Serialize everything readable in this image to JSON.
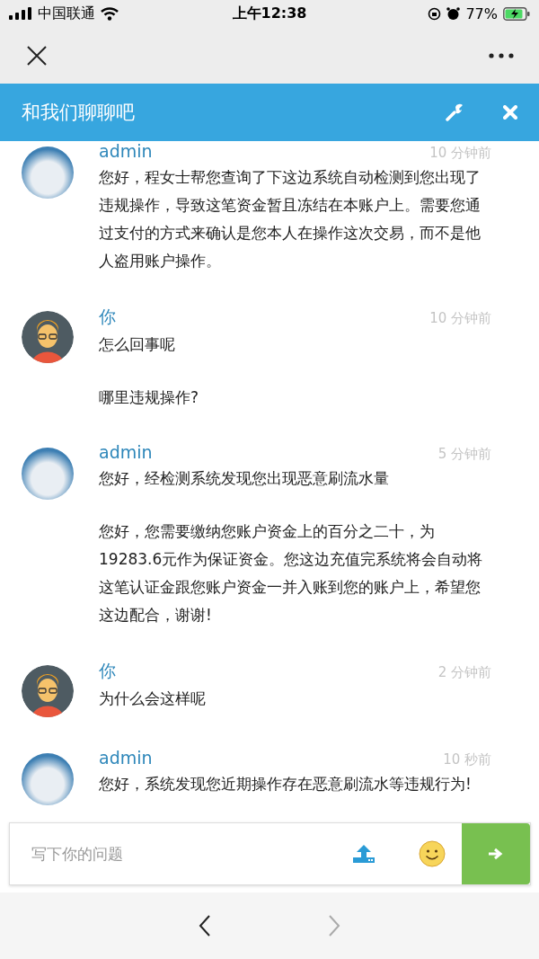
{
  "status_bar": {
    "carrier": "中国联通",
    "time": "上午12:38",
    "battery": "77%"
  },
  "header": {
    "title": "和我们聊聊吧"
  },
  "messages": [
    {
      "kind": "admin",
      "name": "admin",
      "time": "10 分钟前",
      "paragraphs": [
        "您好，程女士帮您查询了下这边系统自动检测到您出现了违规操作，导致这笔资金暂且冻结在本账户上。需要您通过支付的方式来确认是您本人在操作这次交易，而不是他人盗用账户操作。"
      ]
    },
    {
      "kind": "user",
      "name": "你",
      "time": "10 分钟前",
      "paragraphs": [
        "怎么回事呢",
        "哪里违规操作?"
      ]
    },
    {
      "kind": "admin",
      "name": "admin",
      "time": "5 分钟前",
      "paragraphs": [
        "您好，经检测系统发现您出现恶意刷流水量",
        "您好，您需要缴纳您账户资金上的百分之二十，为19283.6元作为保证资金。您这边充值完系统将会自动将这笔认证金跟您账户资金一并入账到您的账户上，希望您这边配合，谢谢!"
      ]
    },
    {
      "kind": "user",
      "name": "你",
      "time": "2 分钟前",
      "paragraphs": [
        "为什么会这样呢"
      ]
    },
    {
      "kind": "admin",
      "name": "admin",
      "time": "10 秒前",
      "paragraphs": [
        "您好，系统发现您近期操作存在恶意刷流水等违规行为!"
      ]
    }
  ],
  "composer": {
    "placeholder": "写下你的问题"
  }
}
